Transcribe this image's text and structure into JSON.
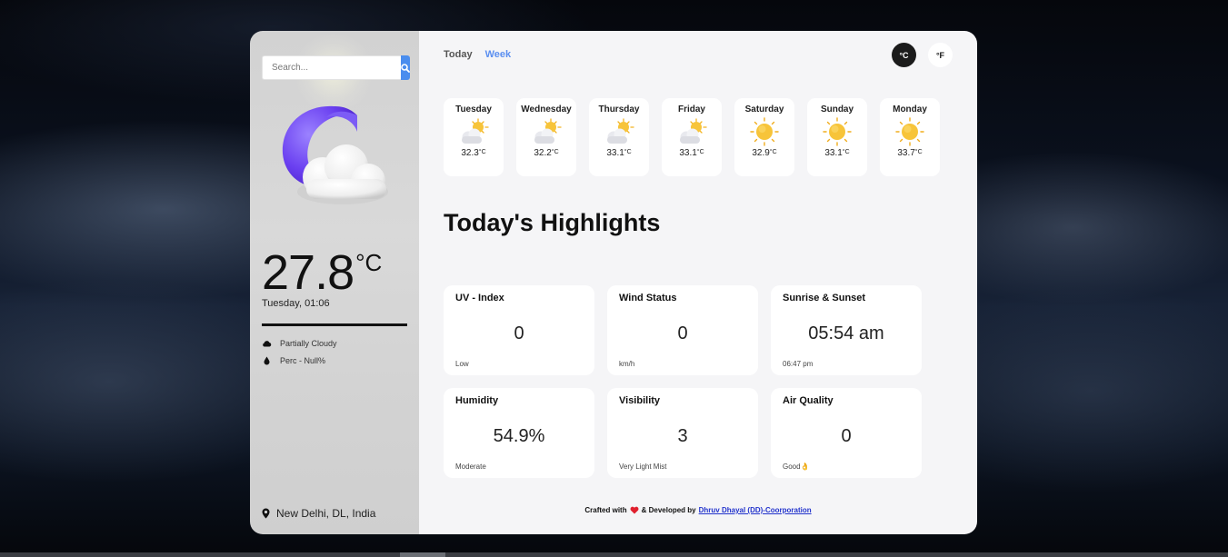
{
  "search": {
    "placeholder": "Search..."
  },
  "current": {
    "temperature": "27.8",
    "unit": "°C",
    "datetime": "Tuesday, 01:06",
    "condition": "Partially Cloudy",
    "precipitation": "Perc - Null%",
    "icon": "cloudy-moon-icon",
    "location": "New Delhi, DL, India"
  },
  "tabs": {
    "today": "Today",
    "week": "Week"
  },
  "units": {
    "celsius": "°C",
    "fahrenheit": "°F"
  },
  "week": [
    {
      "day": "Tuesday",
      "temp": "32.3",
      "unit": "°C",
      "icon": "sun-behind-cloud-icon"
    },
    {
      "day": "Wednesday",
      "temp": "32.2",
      "unit": "°C",
      "icon": "sun-behind-cloud-icon"
    },
    {
      "day": "Thursday",
      "temp": "33.1",
      "unit": "°C",
      "icon": "sun-behind-cloud-icon"
    },
    {
      "day": "Friday",
      "temp": "33.1",
      "unit": "°C",
      "icon": "sun-behind-cloud-icon"
    },
    {
      "day": "Saturday",
      "temp": "32.9",
      "unit": "°C",
      "icon": "sun-icon"
    },
    {
      "day": "Sunday",
      "temp": "33.1",
      "unit": "°C",
      "icon": "sun-icon"
    },
    {
      "day": "Monday",
      "temp": "33.7",
      "unit": "°C",
      "icon": "sun-icon"
    }
  ],
  "highlights": {
    "title": "Today's Highlights",
    "uv": {
      "title": "UV - Index",
      "value": "0",
      "sub": "Low"
    },
    "wind": {
      "title": "Wind Status",
      "value": "0",
      "sub": "km/h"
    },
    "sun": {
      "title": "Sunrise & Sunset",
      "value": "05:54 am",
      "sub": "06:47 pm"
    },
    "humidity": {
      "title": "Humidity",
      "value": "54.9%",
      "sub": "Moderate"
    },
    "visibility": {
      "title": "Visibility",
      "value": "3",
      "sub": "Very Light Mist"
    },
    "air": {
      "title": "Air Quality",
      "value": "0",
      "sub": "Good👌"
    }
  },
  "footer": {
    "prefix": "Crafted with",
    "middle": "& Developed by",
    "link": "Dhruv Dhayal (DD)-Coorporation"
  },
  "colors": {
    "accent": "#4a8dee",
    "week_tab": "#5b8ff0",
    "heart": "#e0202e",
    "panel": "#f5f5f7",
    "sidebar": "#d6d6d6"
  }
}
